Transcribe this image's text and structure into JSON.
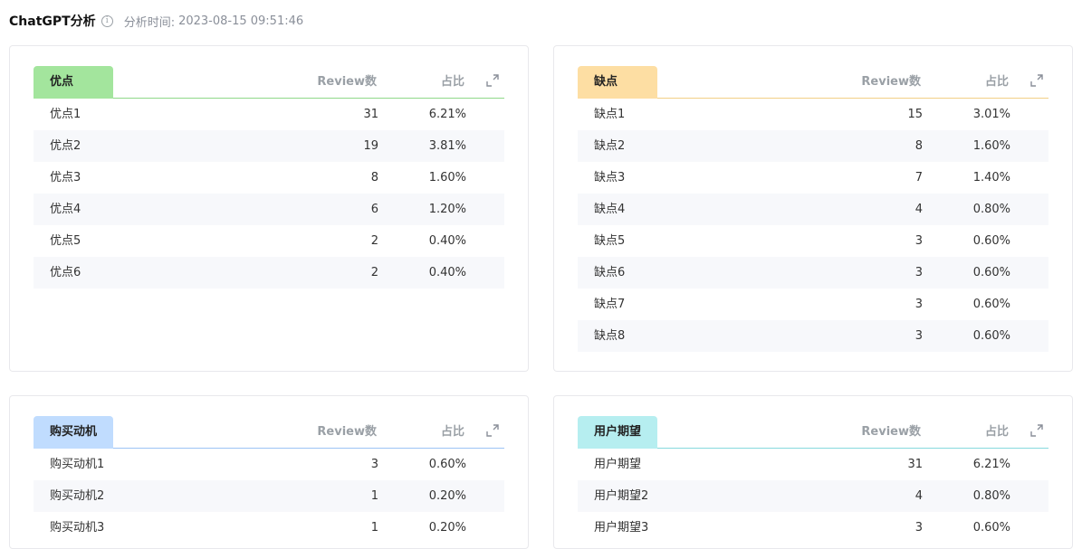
{
  "header": {
    "title": "ChatGPT分析",
    "time_label": "分析时间:",
    "time_value": "2023-08-15 09:51:46"
  },
  "columns": {
    "review": "Review数",
    "percent": "占比"
  },
  "colors": {
    "pros": "#a3e59d",
    "cons": "#fddea3",
    "motivation": "#c0dcfe",
    "expectation": "#b6eef0"
  },
  "cards": {
    "pros": {
      "label": "优点",
      "rows": [
        {
          "name": "优点1",
          "count": "31",
          "pct": "6.21%"
        },
        {
          "name": "优点2",
          "count": "19",
          "pct": "3.81%"
        },
        {
          "name": "优点3",
          "count": "8",
          "pct": "1.60%"
        },
        {
          "name": "优点4",
          "count": "6",
          "pct": "1.20%"
        },
        {
          "name": "优点5",
          "count": "2",
          "pct": "0.40%"
        },
        {
          "name": "优点6",
          "count": "2",
          "pct": "0.40%"
        }
      ]
    },
    "cons": {
      "label": "缺点",
      "rows": [
        {
          "name": "缺点1",
          "count": "15",
          "pct": "3.01%"
        },
        {
          "name": "缺点2",
          "count": "8",
          "pct": "1.60%"
        },
        {
          "name": "缺点3",
          "count": "7",
          "pct": "1.40%"
        },
        {
          "name": "缺点4",
          "count": "4",
          "pct": "0.80%"
        },
        {
          "name": "缺点5",
          "count": "3",
          "pct": "0.60%"
        },
        {
          "name": "缺点6",
          "count": "3",
          "pct": "0.60%"
        },
        {
          "name": "缺点7",
          "count": "3",
          "pct": "0.60%"
        },
        {
          "name": "缺点8",
          "count": "3",
          "pct": "0.60%"
        }
      ]
    },
    "motivation": {
      "label": "购买动机",
      "rows": [
        {
          "name": "购买动机1",
          "count": "3",
          "pct": "0.60%"
        },
        {
          "name": "购买动机2",
          "count": "1",
          "pct": "0.20%"
        },
        {
          "name": "购买动机3",
          "count": "1",
          "pct": "0.20%"
        }
      ]
    },
    "expectation": {
      "label": "用户期望",
      "rows": [
        {
          "name": "用户期望",
          "count": "31",
          "pct": "6.21%"
        },
        {
          "name": "用户期望2",
          "count": "4",
          "pct": "0.80%"
        },
        {
          "name": "用户期望3",
          "count": "3",
          "pct": "0.60%"
        }
      ]
    }
  }
}
